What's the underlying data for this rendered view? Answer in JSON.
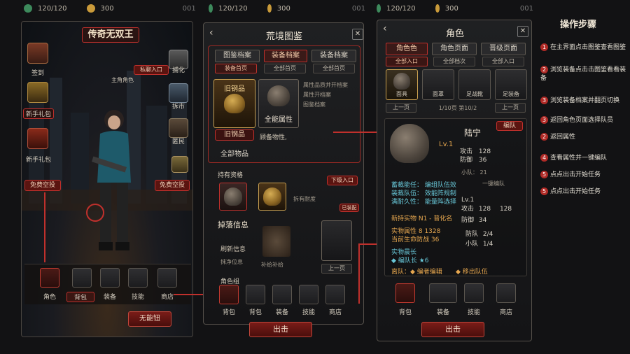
{
  "hud": {
    "p1": {
      "energy": "120/120",
      "coins": "300",
      "extra": "001"
    },
    "p2": {
      "energy": "120/120",
      "coins": "300",
      "extra": "001"
    },
    "p3": {
      "energy": "120/120",
      "coins": "300",
      "extra": "001"
    }
  },
  "main": {
    "title": "传奇无双王",
    "left_icons": [
      "签到",
      "新手礼包",
      "新手礼包"
    ],
    "right_icons": [
      "捕化",
      "拆市",
      "匿民"
    ],
    "annotations": {
      "event_entry": "私聊入口",
      "free_airdrop": "免费空投",
      "free_airdrop_left": "免费空投",
      "main_role": "主角角色"
    },
    "bottom_slots": [
      "角色",
      "背包",
      "装备",
      "技能",
      "商店"
    ],
    "confirm_button": "无能钮"
  },
  "codex": {
    "title": "荒境图鉴",
    "tabs": [
      "图鉴档案",
      "装备档案",
      "装备档案"
    ],
    "subtabs": [
      "装备首页",
      "全部首页",
      "全部首页"
    ],
    "card1_title": "旧钢品",
    "card1_sub": "旧钢品",
    "card2_name": "全能属性",
    "all_items": "全部物品",
    "desc_lines": [
      "属性品质并开档案",
      "",
      "",
      "属性开档案",
      "图鉴档案",
      "",
      "",
      ""
    ],
    "desc2": "顾备物性,",
    "owned_label": "持有资格",
    "drop_label": "下级入口",
    "owned_note": "拆有耐度",
    "drop_info_btn": "已装配",
    "drop_title": "掉落信息",
    "drop_line1": "刷新信息",
    "drop_line2": "抹净位息",
    "drop_caption": "补给补给",
    "prev_btn": "上一页",
    "role_label": "角色组",
    "bottom_slots": [
      "背包",
      "背包",
      "装备",
      "技能",
      "商店"
    ],
    "out_button": "出击"
  },
  "role": {
    "title": "角色",
    "tabs": [
      "角色色",
      "角色页面",
      "晋级页面"
    ],
    "subtabs": [
      "全部入口",
      "全部档次",
      "全部入口"
    ],
    "slots": [
      "面具",
      "面罩",
      "足战靴",
      "足装备"
    ],
    "prev": "上一页",
    "page": "1/10页 第10/2",
    "next": "上一页",
    "hero_name": "陆宁",
    "team_btn": "编队",
    "level": "Lv.1",
    "atk_label": "攻击",
    "atk": "128",
    "def_label": "防御",
    "def": "36",
    "squad_label": "小队：",
    "squad": "21",
    "skill1": "蓄裁能任：",
    "skill1_val": "编组队伍效",
    "skill2": "装裁队伍：",
    "skill2_val": "效能阵规制",
    "skill3": "满耐久性：",
    "skill3_val": "能量阵选择",
    "one_key": "一键编队",
    "attr_atk_label": "攻击",
    "attr_atk1": "128",
    "attr_atk2": "128",
    "attr_def_label": "防御",
    "attr_def": "34",
    "attr_lv": "Lv.1",
    "new_equip": "新持实物 N1 - 普化名",
    "cur_pos1": "实物属性 8  1328",
    "cur_pos2": "当前生命防战  36",
    "team_size_label": "防队",
    "team_size": "2/4",
    "small_team_label": "小队",
    "small_team": "1/4",
    "growth_title": "实物晨长",
    "growth_line": "◆ 编队长 ★6",
    "cmd1": "离队：◆ 编者编辑",
    "cmd2": "◆ 移出队伍",
    "bottom_slots": [
      "背包",
      "装备",
      "技能",
      "商店"
    ],
    "out_button": "出击"
  },
  "guide": {
    "title": "操作步骤",
    "steps": [
      {
        "n": "1",
        "text": "在主界面点击图鉴查看图鉴"
      },
      {
        "n": "2",
        "text": "浏览装备点击击图鉴看看装备"
      },
      {
        "n": "3",
        "text": "浏览装备档案并翻页切换"
      },
      {
        "n": "3",
        "text": "返回角色页面选择队员"
      },
      {
        "n": "2",
        "text": "返回属性"
      },
      {
        "n": "4",
        "text": "查看属性并一键编队"
      },
      {
        "n": "5",
        "text": "点点出击开始任务"
      },
      {
        "n": "5",
        "text": "点点出击开始任务"
      }
    ]
  },
  "colors": {
    "accent": "#c0302c",
    "gold": "#d6ad54",
    "panel": "#1f2022",
    "cyan": "#68c7d8"
  }
}
